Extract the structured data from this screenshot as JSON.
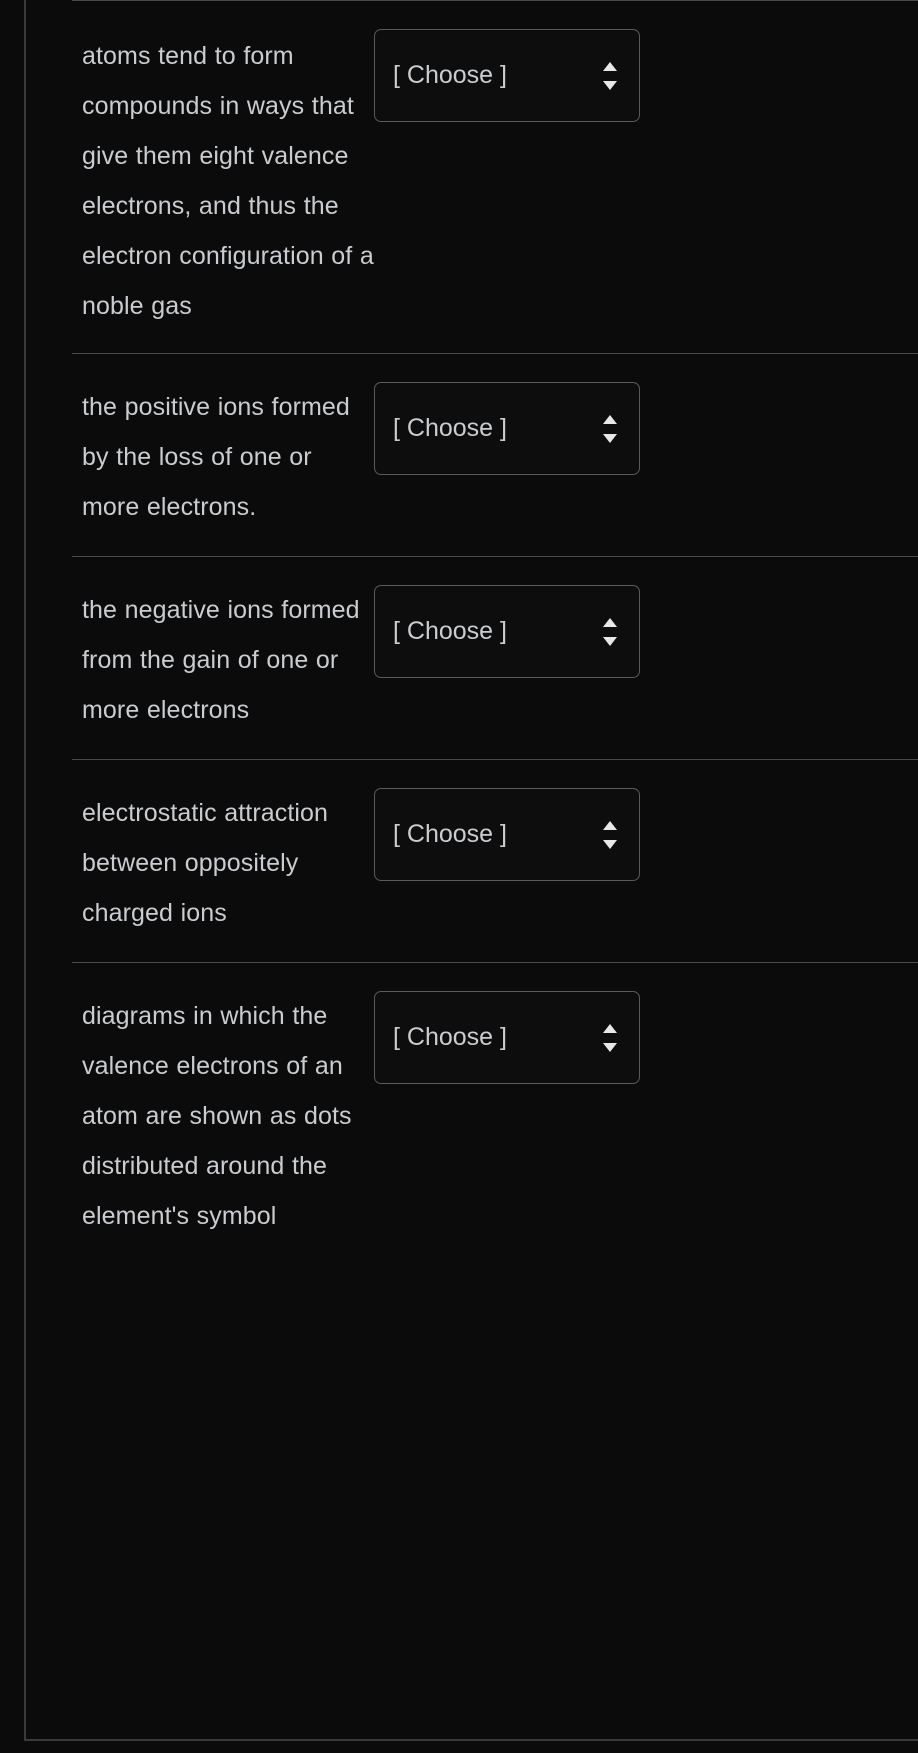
{
  "question": {
    "type": "matching-dropdowns",
    "background_color": "#0b0b0b",
    "text_color": "#c9ccd0",
    "border_color": "#3a3a3a",
    "divider_color": "#4a4a4a",
    "select_border_color": "#5a5a5a",
    "rows": [
      {
        "prompt": "atoms tend to form compounds in ways that give them eight valence electrons, and thus the electron configuration of a noble gas",
        "select_value": "[ Choose ]",
        "chevron_icon": "chevron-up-down-icon"
      },
      {
        "prompt": "the positive ions formed by the loss of one or more electrons.",
        "select_value": "[ Choose ]",
        "chevron_icon": "chevron-up-down-icon"
      },
      {
        "prompt": "the negative ions formed from the gain of one or more electrons",
        "select_value": "[ Choose ]",
        "chevron_icon": "chevron-up-down-icon"
      },
      {
        "prompt": "electrostatic attraction between oppositely charged ions",
        "select_value": "[ Choose ]",
        "chevron_icon": "chevron-up-down-icon"
      },
      {
        "prompt": "diagrams in which the valence electrons of an atom are shown as dots distributed around the element's symbol",
        "select_value": "[ Choose ]",
        "chevron_icon": "chevron-up-down-icon"
      }
    ]
  }
}
